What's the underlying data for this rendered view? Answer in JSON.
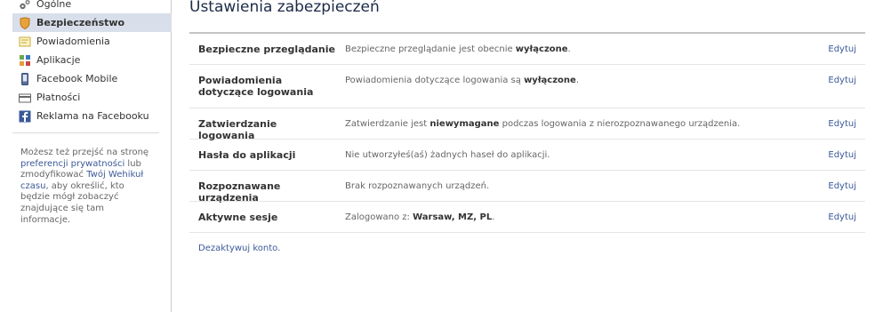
{
  "sidebar": {
    "items": [
      {
        "label": "Ogólne",
        "icon": "gears-icon"
      },
      {
        "label": "Bezpieczeństwo",
        "icon": "shield-icon",
        "active": true
      },
      {
        "label": "Powiadomienia",
        "icon": "notification-icon"
      },
      {
        "label": "Aplikacje",
        "icon": "apps-icon"
      },
      {
        "label": "Facebook Mobile",
        "icon": "mobile-phone-icon"
      },
      {
        "label": "Płatności",
        "icon": "payments-icon"
      },
      {
        "label": "Reklama na Facebooku",
        "icon": "facebook-ads-icon"
      }
    ],
    "note": {
      "text1": "Możesz też przejść na stronę ",
      "link1": "preferencji prywatności",
      "text2": " lub zmodyfikować ",
      "link2": "Twój Wehikuł czasu",
      "text3": ", aby określić, kto będzie mógł zobaczyć znajdujące się tam informacje."
    }
  },
  "main": {
    "title": "Ustawienia zabezpieczeń",
    "edit_label": "Edytuj",
    "rows": [
      {
        "label": "Bezpieczne przeglądanie",
        "desc_before": "Bezpieczne przeglądanie jest obecnie ",
        "desc_bold": "wyłączone",
        "desc_after": "."
      },
      {
        "label": "Powiadomienia dotyczące logowania",
        "desc_before": "Powiadomienia dotyczące logowania są ",
        "desc_bold": "wyłączone",
        "desc_after": "."
      },
      {
        "label": "Zatwierdzanie logowania",
        "desc_before": "Zatwierdzanie jest ",
        "desc_bold": "niewymagane",
        "desc_after": " podczas logowania z nierozpoznawanego urządzenia."
      },
      {
        "label": "Hasła do aplikacji",
        "desc_before": "Nie utworzyłeś(aś) żadnych haseł do aplikacji.",
        "desc_bold": "",
        "desc_after": ""
      },
      {
        "label": "Rozpoznawane urządzenia",
        "desc_before": "Brak rozpoznawanych urządzeń.",
        "desc_bold": "",
        "desc_after": ""
      },
      {
        "label": "Aktywne sesje",
        "desc_before": "Zalogowano z: ",
        "desc_bold": "Warsaw, MZ, PL",
        "desc_after": "."
      }
    ],
    "deactivate_label": "Dezaktywuj konto."
  }
}
